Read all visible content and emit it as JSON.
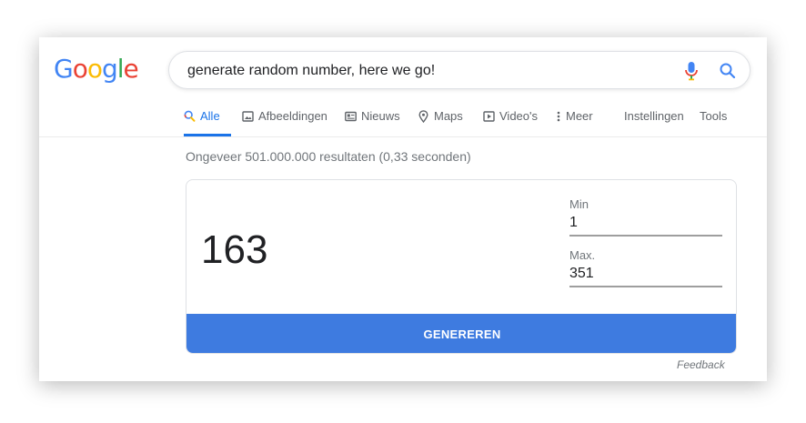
{
  "logo": {
    "letters": [
      {
        "char": "G",
        "color": "#4285F4"
      },
      {
        "char": "o",
        "color": "#EA4335"
      },
      {
        "char": "o",
        "color": "#FBBC05"
      },
      {
        "char": "g",
        "color": "#4285F4"
      },
      {
        "char": "l",
        "color": "#34A853"
      },
      {
        "char": "e",
        "color": "#EA4335"
      }
    ]
  },
  "search": {
    "query": "generate random number, here we go!",
    "icons": [
      "microphone-icon",
      "search-icon"
    ]
  },
  "tabs": [
    {
      "label": "Alle",
      "icon": "search-icon",
      "active": true
    },
    {
      "label": "Afbeeldingen",
      "icon": "image-icon",
      "active": false
    },
    {
      "label": "Nieuws",
      "icon": "news-icon",
      "active": false
    },
    {
      "label": "Maps",
      "icon": "map-pin-icon",
      "active": false
    },
    {
      "label": "Video's",
      "icon": "play-icon",
      "active": false
    },
    {
      "label": "Meer",
      "icon": "more-vertical-icon",
      "active": false
    },
    {
      "label": "Instellingen",
      "active": false
    },
    {
      "label": "Tools",
      "active": false
    }
  ],
  "results_stats": "Ongeveer 501.000.000 resultaten (0,33 seconden)",
  "generator": {
    "result": "163",
    "min_label": "Min",
    "min_value": "1",
    "max_label": "Max.",
    "max_value": "351",
    "button_label": "GENEREREN"
  },
  "feedback_label": "Feedback",
  "colors": {
    "accent": "#1a73e8",
    "button": "#3e7be0",
    "muted_text": "#70757a"
  }
}
